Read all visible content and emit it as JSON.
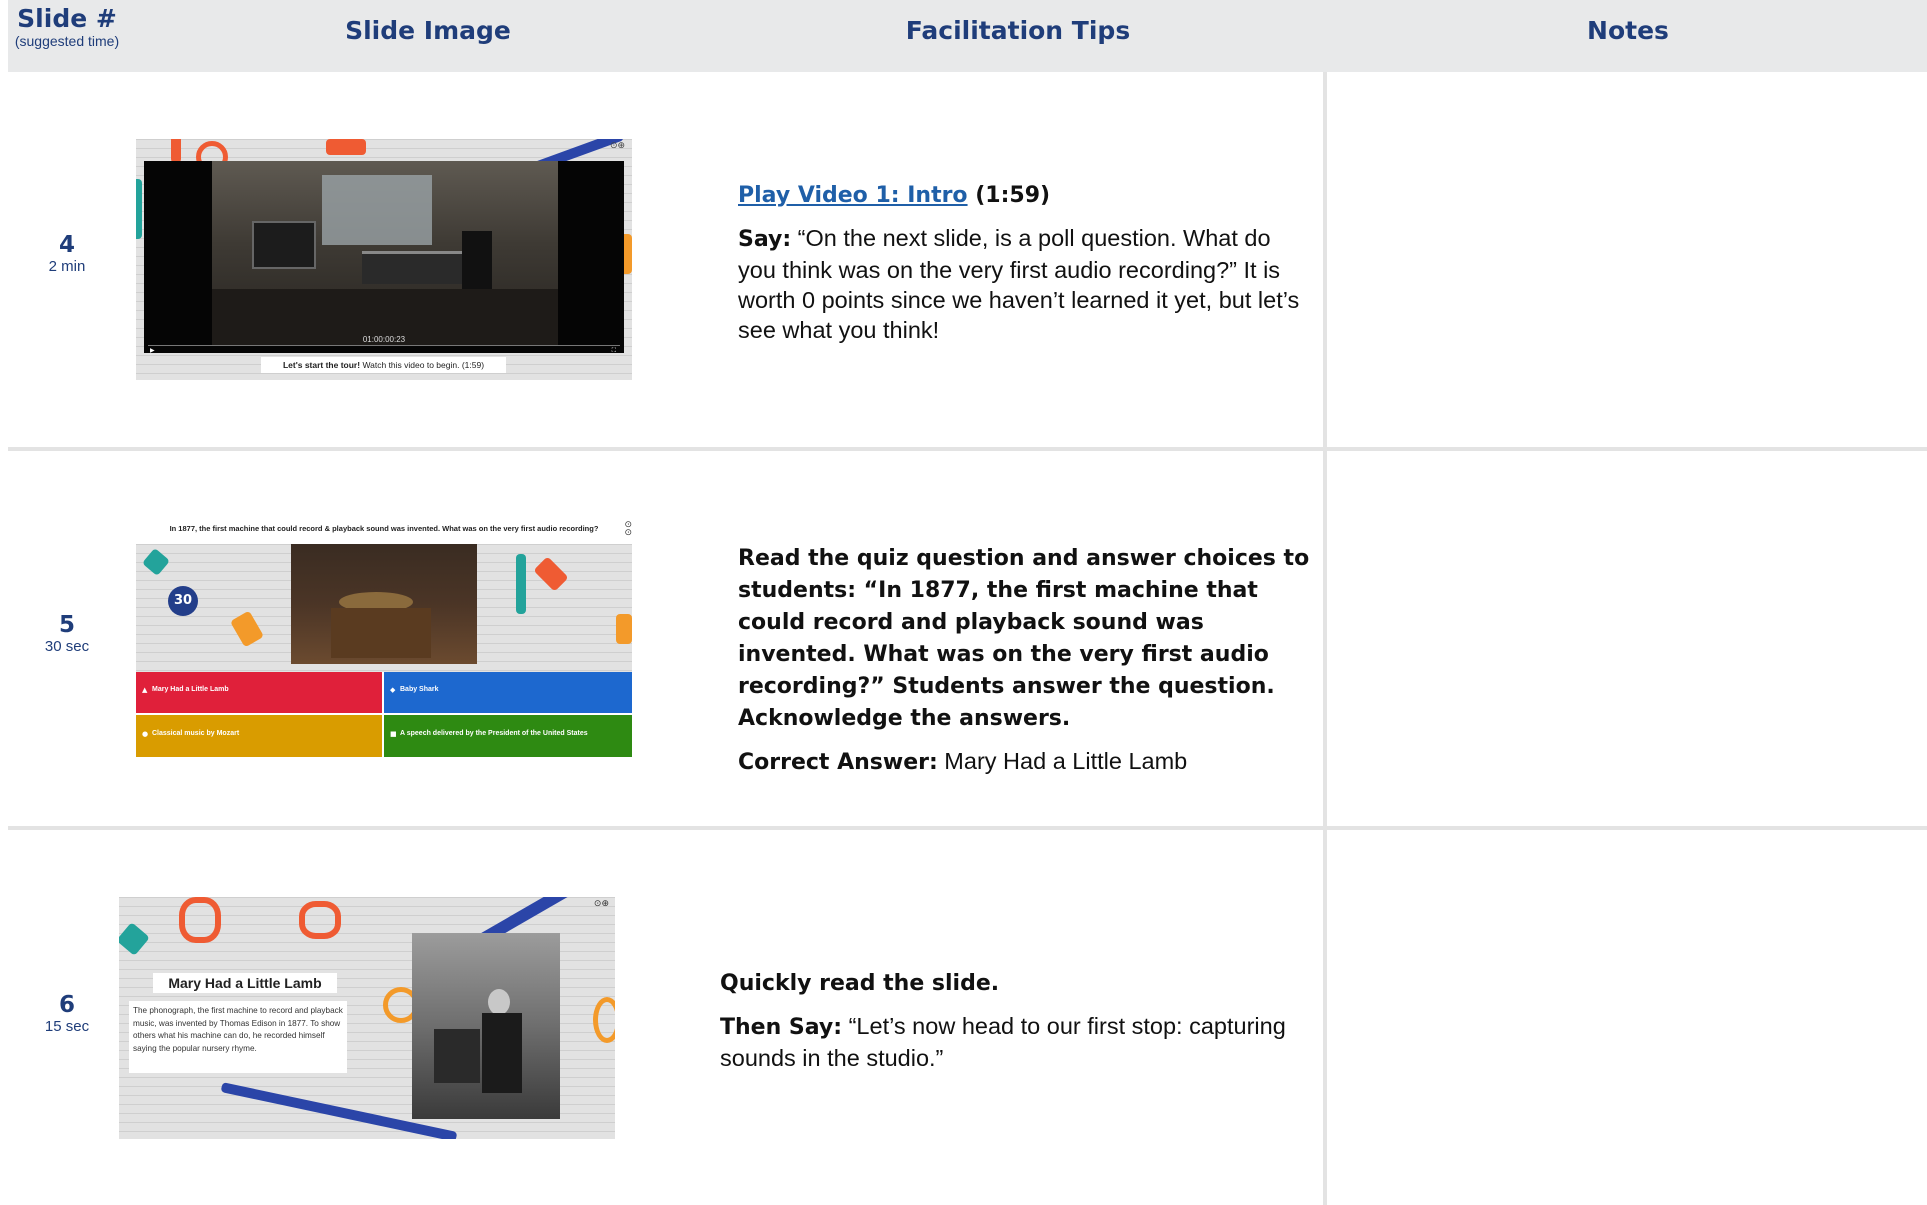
{
  "header": {
    "slide_col": "Slide #",
    "slide_col_sub": "(suggested time)",
    "image_col": "Slide Image",
    "tips_col": "Facilitation Tips",
    "notes_col": "Notes"
  },
  "rows": [
    {
      "slide_number": "4",
      "duration": "2 min",
      "thumbnail": {
        "timecode": "01:00:00:23",
        "caption_bold": "Let's start the tour!",
        "caption_rest": " Watch this video to begin. (1:59)"
      },
      "link_text": "Play Video 1: Intro",
      "link_duration": " (1:59)",
      "say_label": "Say:",
      "say_text": " “On the next slide, is a poll question. What do you think was on the very first audio recording?” It is worth 0 points since we haven’t learned it yet, but let’s see what you think!"
    },
    {
      "slide_number": "5",
      "duration": "30 sec",
      "thumbnail": {
        "question": "In 1877, the first machine that could record & playback sound was invented. What was on the very first audio recording?",
        "timer": "30",
        "answers": [
          {
            "symbol": "▲",
            "label": "Mary Had a Little Lamb",
            "color": "#e0203a"
          },
          {
            "symbol": "◆",
            "label": "Baby Shark",
            "color": "#1d68cf"
          },
          {
            "symbol": "●",
            "label": "Classical music by Mozart",
            "color": "#d99c00"
          },
          {
            "symbol": "■",
            "label": "A speech delivered by the President of the United States",
            "color": "#2e8a12"
          }
        ]
      },
      "instruction": "Read the quiz question and answer choices to students: “In 1877, the first machine that could record and playback sound was invented. What was on the very first audio recording?” Students answer the question. Acknowledge the answers.",
      "answer_label": "Correct Answer:",
      "answer_text": " Mary Had a Little Lamb"
    },
    {
      "slide_number": "6",
      "duration": "15 sec",
      "thumbnail": {
        "title": "Mary Had a Little Lamb",
        "body": "The phonograph, the first machine to record and playback music, was invented by Thomas Edison in 1877. To show others what his machine can do, he recorded himself saying the popular nursery rhyme."
      },
      "instruction": "Quickly read the slide.",
      "then_say_label": "Then Say:",
      "then_say_text": " “Let’s now head to our first stop: capturing sounds in the studio.”"
    }
  ],
  "colors": {
    "header_bg": "#e8e9ea",
    "header_text": "#1f3d7a",
    "link": "#1f5fa8",
    "divider": "#e3e3e3"
  }
}
